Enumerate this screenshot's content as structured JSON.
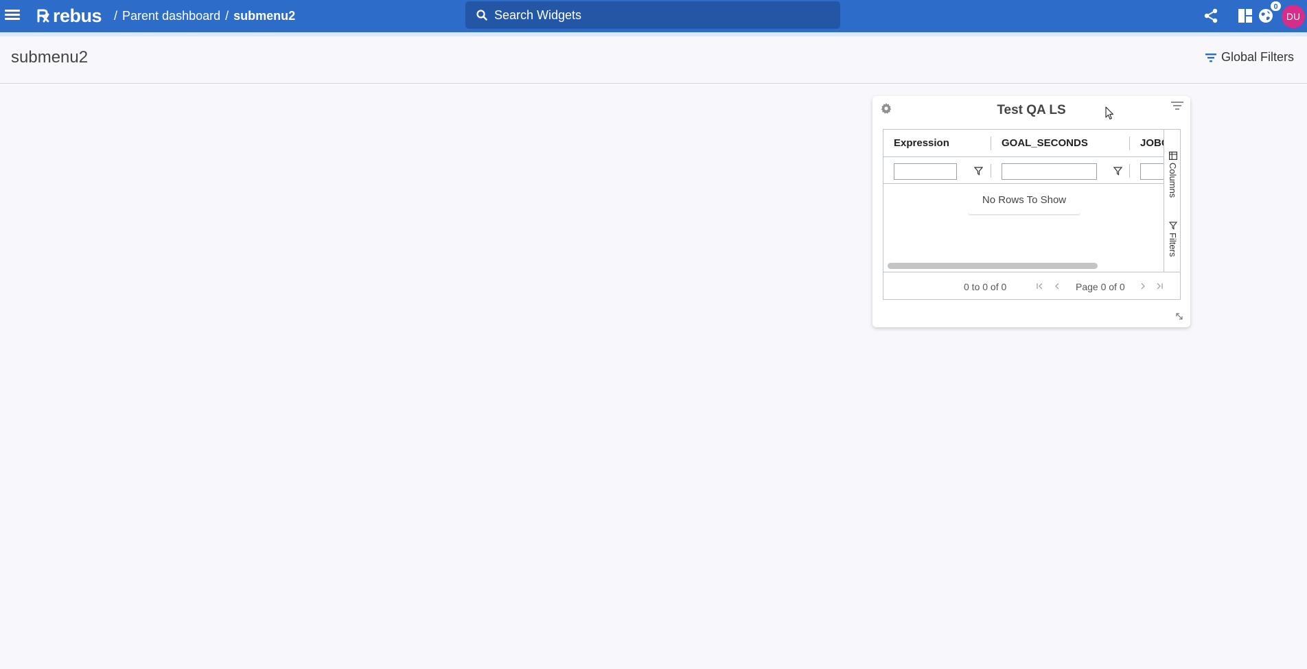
{
  "header": {
    "logo_text": "rebus",
    "breadcrumb": {
      "separator": "/",
      "parent": "Parent dashboard",
      "current": "submenu2"
    },
    "search": {
      "placeholder": "Search Widgets",
      "value": ""
    },
    "notification_count": "0",
    "avatar_initials": "DU",
    "colors": {
      "bar": "#2d6cc9",
      "search": "#2456a6",
      "avatar": "#d62c8a"
    },
    "icons": [
      "menu-icon",
      "search-icon",
      "share-icon",
      "dashboard-layout-icon",
      "notifications-globe-icon"
    ]
  },
  "page": {
    "title": "submenu2",
    "global_filters_label": "Global Filters"
  },
  "widget": {
    "title": "Test QA LS",
    "columns": [
      "Expression",
      "GOAL_SECONDS",
      "JOBC"
    ],
    "filters": {
      "col1": "",
      "col2": "",
      "col3": ""
    },
    "no_rows_text": "No Rows To Show",
    "side_tabs": {
      "columns": "Columns",
      "filters": "Filters"
    },
    "paging": {
      "summary": "0 to 0 of 0",
      "page_text": "Page 0 of 0"
    }
  }
}
